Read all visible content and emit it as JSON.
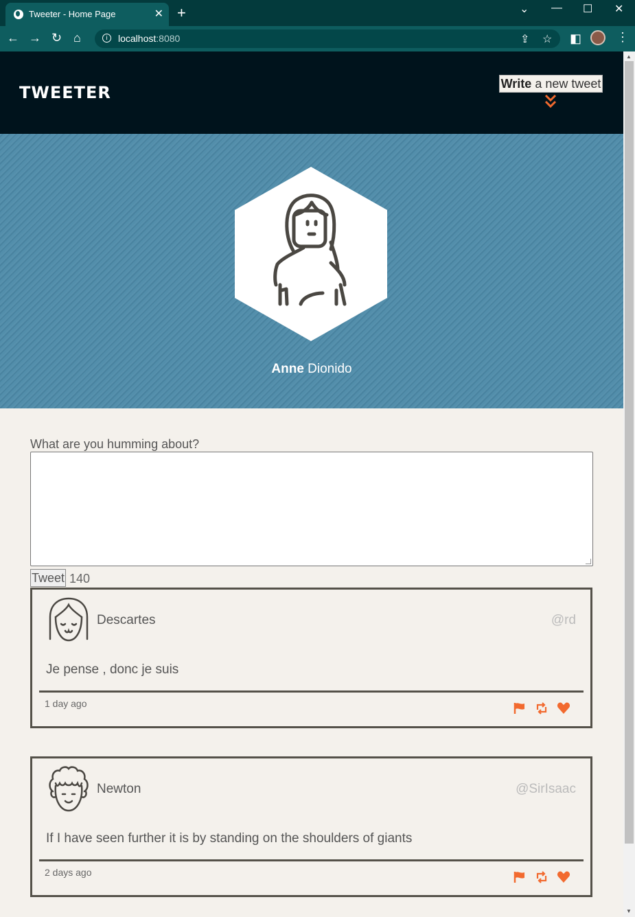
{
  "browser": {
    "tab_title": "Tweeter - Home Page",
    "url_host": "localhost",
    "url_port": ":8080"
  },
  "header": {
    "logo": "TWEETER",
    "compose_bold": "Write",
    "compose_rest": " a new tweet"
  },
  "profile": {
    "first_name": "Anne",
    "last_name": " Dionido"
  },
  "compose": {
    "prompt": "What are you humming about?",
    "text_value": "",
    "button_label": "Tweet",
    "counter": "140"
  },
  "tweets": [
    {
      "name": "Descartes",
      "handle": "@rd",
      "content": "Je pense , donc je suis",
      "time": "1 day ago"
    },
    {
      "name": "Newton",
      "handle": "@SirIsaac",
      "content": "If I have seen further it is by standing on the shoulders of giants",
      "time": "2 days ago"
    }
  ],
  "colors": {
    "header_bg": "#00131c",
    "banner_bg": "#4d8aa8",
    "accent": "#f26a2f",
    "page_bg": "#f4f1ec",
    "border": "#545149"
  },
  "icons": {
    "flag": "flag-icon",
    "retweet": "retweet-icon",
    "like": "heart-icon"
  }
}
